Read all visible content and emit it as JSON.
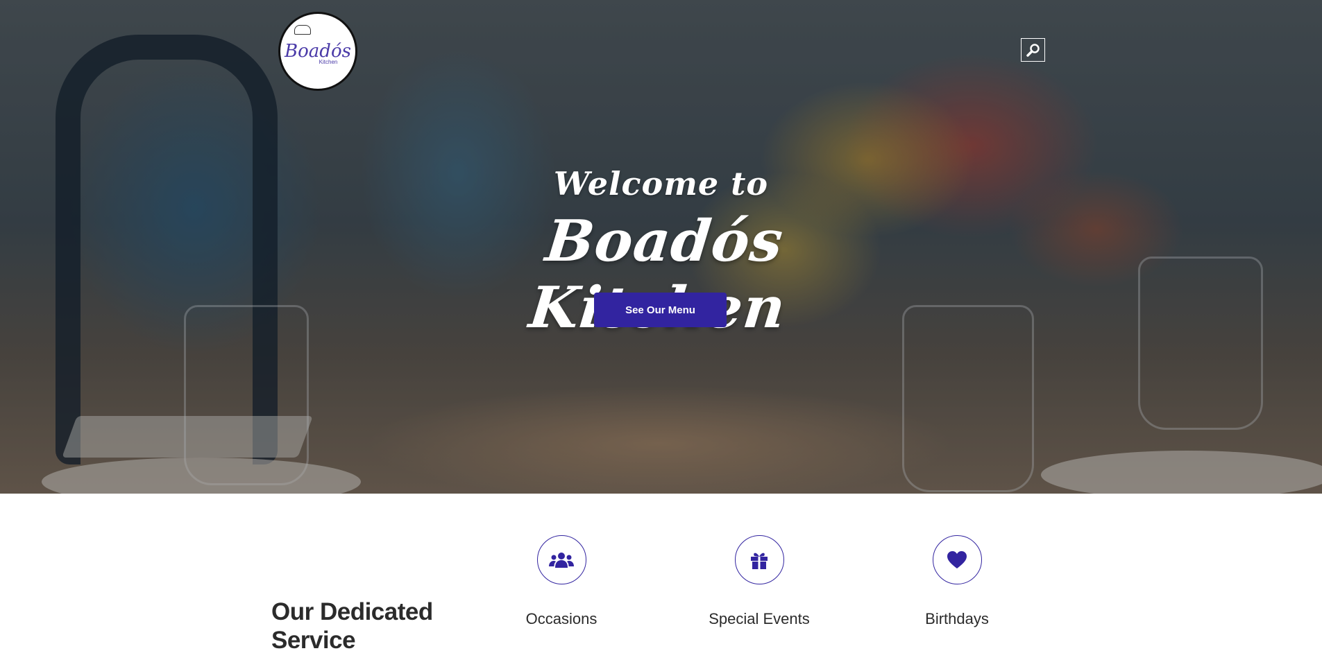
{
  "hero": {
    "welcome_text": "Welcome to",
    "brand_title": "Boadós Kitchen",
    "menu_button_label": "See Our Menu"
  },
  "logo": {
    "name": "Boadós",
    "sub": "Kitchen"
  },
  "services": {
    "title": "Our Dedicated Service",
    "items": [
      {
        "label": "Occasions",
        "icon": "users-icon"
      },
      {
        "label": "Special Events",
        "icon": "gift-icon"
      },
      {
        "label": "Birthdays",
        "icon": "heart-icon"
      }
    ],
    "accent_color": "#3224a0"
  }
}
